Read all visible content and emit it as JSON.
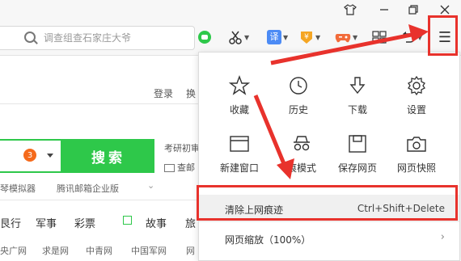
{
  "toolbar": {
    "search_placeholder": "调查组查石家庄大爷",
    "translate_label": "译",
    "menu_label": "☰"
  },
  "page": {
    "login": "登录",
    "login_partial": "换",
    "search_badge": "3",
    "search_button": "搜索",
    "exam_partial": "考研初审",
    "mail_partial": "查邮",
    "links_row": [
      "琴模拟器",
      "腾讯邮箱企业版"
    ],
    "nav_row": [
      "艮行",
      "军事",
      "彩票",
      "故事",
      "旅"
    ],
    "site_row": [
      "央广网",
      "求是网",
      "中青网",
      "中国军网",
      "网"
    ]
  },
  "menu": {
    "grid": [
      {
        "label": "收藏",
        "icon": "star-icon"
      },
      {
        "label": "历史",
        "icon": "clock-icon"
      },
      {
        "label": "下载",
        "icon": "download-icon"
      },
      {
        "label": "设置",
        "icon": "gear-icon"
      },
      {
        "label": "新建窗口",
        "icon": "window-icon"
      },
      {
        "label": "痕模式",
        "icon": "incognito-icon"
      },
      {
        "label": "保存网页",
        "icon": "save-icon"
      },
      {
        "label": "网页快照",
        "icon": "camera-icon"
      }
    ],
    "clear_history": "清除上网痕迹",
    "clear_shortcut": "Ctrl+Shift+Delete",
    "zoom_label": "网页缩放（100%）"
  },
  "colors": {
    "accent_green": "#2ec84a",
    "annotation_red": "#e8322c"
  }
}
